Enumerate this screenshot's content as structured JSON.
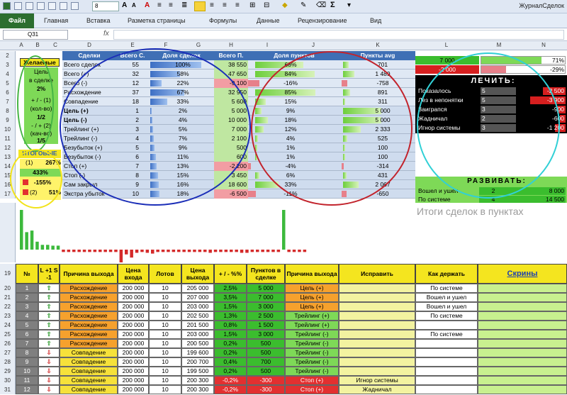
{
  "titlebar": {
    "text": "ЖурналСделок"
  },
  "ribbon": {
    "file": "Файл",
    "tabs": [
      "Главная",
      "Вставка",
      "Разметка страницы",
      "Формулы",
      "Данные",
      "Рецензирование",
      "Вид"
    ]
  },
  "font_size": "8",
  "namebox": "Q31",
  "col_letters": [
    "A",
    "B",
    "C",
    "D",
    "E",
    "F",
    "G",
    "H",
    "I",
    "J",
    "K",
    "L",
    "M",
    "N"
  ],
  "left_panel": {
    "title": "Желаемые",
    "goal_line1": "Цель",
    "goal_line2": "в сделке",
    "goal_pct": "2%",
    "plus_minus1": "+ / - (1)",
    "kolvo": "(кол-во)",
    "ratio1": "1/2",
    "plus_minus2": "- / + (2)",
    "kachvo": "(кач-во)",
    "ratio2": "1/5",
    "itog": "ИТОГОВЫЕ",
    "i1_label": "(1)",
    "i1_val": "267%",
    "i2_val": "433%",
    "i3_val": "-155%",
    "i4_label": "(2)",
    "i4_val": "51%"
  },
  "stats": {
    "headers": [
      "Сделки",
      "Всего С.",
      "Доля сделок",
      "Всего П.",
      "Доля пунктов",
      "Пункты avg"
    ],
    "rows": [
      {
        "name": "Всего сделок",
        "n": "55",
        "pct": "100%",
        "pts": "38 550",
        "ppct": "68%",
        "avg": "701"
      },
      {
        "name": "Всего (+)",
        "n": "32",
        "pct": "58%",
        "pts": "47 650",
        "ppct": "84%",
        "avg": "1 489"
      },
      {
        "name": "Всего (-)",
        "n": "12",
        "pct": "22%",
        "pts": "-9 100",
        "ppct": "-16%",
        "avg": "-758"
      },
      {
        "name": "Расхождение",
        "n": "37",
        "pct": "67%",
        "pts": "32 950",
        "ppct": "85%",
        "avg": "891"
      },
      {
        "name": "Совпадение",
        "n": "18",
        "pct": "33%",
        "pts": "5 600",
        "ppct": "15%",
        "avg": "311"
      },
      {
        "name": "Цель (+)",
        "n": "1",
        "pct": "2%",
        "pts": "5 000",
        "ppct": "9%",
        "avg": "5 000"
      },
      {
        "name": "Цель (-)",
        "n": "2",
        "pct": "4%",
        "pts": "10 000",
        "ppct": "18%",
        "avg": "5 000"
      },
      {
        "name": "Трейлинг (+)",
        "n": "3",
        "pct": "5%",
        "pts": "7 000",
        "ppct": "12%",
        "avg": "2 333"
      },
      {
        "name": "Трейлинг (-)",
        "n": "4",
        "pct": "7%",
        "pts": "2 100",
        "ppct": "4%",
        "avg": "525"
      },
      {
        "name": "Безубыток (+)",
        "n": "5",
        "pct": "9%",
        "pts": "500",
        "ppct": "1%",
        "avg": "100"
      },
      {
        "name": "Безубыток (-)",
        "n": "6",
        "pct": "11%",
        "pts": "600",
        "ppct": "1%",
        "avg": "100"
      },
      {
        "name": "Стоп (+)",
        "n": "7",
        "pct": "13%",
        "pts": "-2 200",
        "ppct": "-4%",
        "avg": "-314"
      },
      {
        "name": "Стоп (-)",
        "n": "8",
        "pct": "15%",
        "pts": "3 450",
        "ppct": "6%",
        "avg": "431"
      },
      {
        "name": "Сам закрыл",
        "n": "9",
        "pct": "16%",
        "pts": "18 600",
        "ppct": "33%",
        "avg": "2 067"
      },
      {
        "name": "Экстра убыток",
        "n": "10",
        "pct": "18%",
        "pts": "-6 500",
        "ppct": "-11%",
        "avg": "-650"
      }
    ]
  },
  "right_panel": {
    "top1_val": "7 000",
    "top1_pct": "71%",
    "top2_val": "-2 000",
    "top2_pct": "-29%",
    "lechit": "ЛЕЧИТЬ:",
    "lechit_items": [
      {
        "label": "Показалось",
        "n": "5",
        "v": "-2 500"
      },
      {
        "label": "Лез в непонятки",
        "n": "5",
        "v": "-3 900"
      },
      {
        "label": "Заиграпся",
        "n": "3",
        "v": "-900"
      },
      {
        "label": "Жадничал",
        "n": "2",
        "v": "-600"
      },
      {
        "label": "Игнор системы",
        "n": "3",
        "v": "-1 200"
      }
    ],
    "razvivat": "РАЗВИВАТЬ:",
    "razv_items": [
      {
        "label": "Вошел и ушел",
        "n": "2",
        "v": "8 000"
      },
      {
        "label": "По системе",
        "n": "4",
        "v": "14 500"
      }
    ]
  },
  "chart_data": {
    "type": "bar",
    "title": "Итоги сделок в пунктах",
    "values": [
      5000,
      2200,
      2400,
      1000,
      600,
      600,
      500,
      500,
      -300,
      -300,
      -300,
      -300,
      -300,
      -300,
      -300,
      -300,
      -300,
      -300,
      -300,
      -2200,
      -600,
      -1000,
      -400,
      -300,
      -400,
      -500,
      -300,
      -300,
      -300,
      -300,
      -300,
      -300,
      -300,
      -300,
      -300,
      -300,
      -400,
      -300,
      -300,
      -300,
      -300,
      -300,
      -400,
      -400,
      -300,
      -300,
      -300,
      -300,
      -300,
      -300,
      5000,
      -300,
      -300,
      -300,
      -300
    ],
    "pos_color": "#3cb93c",
    "neg_color": "#d42a2a"
  },
  "journal": {
    "headers": [
      "№",
      "L +1\nS -1",
      "Причина выхода",
      "Цена входа",
      "Лотов",
      "Цена выхода",
      "+ / - %%",
      "Пунктов в сделке",
      "Причина выхода",
      "Исправить",
      "Как держать",
      "Скрины"
    ],
    "rows": [
      {
        "rn": "20",
        "no": "1",
        "dir": "up",
        "reason": "Расхождение",
        "in": "200 000",
        "lots": "10",
        "out": "205 000",
        "pct": "2,5%",
        "pts": "5 000",
        "exit": "Цель (+)",
        "fix": "",
        "hold": "По системе"
      },
      {
        "rn": "21",
        "no": "2",
        "dir": "up",
        "reason": "Расхождение",
        "in": "200 000",
        "lots": "10",
        "out": "207 000",
        "pct": "3,5%",
        "pts": "7 000",
        "exit": "Цель (+)",
        "fix": "",
        "hold": "Вошел и ушел"
      },
      {
        "rn": "22",
        "no": "3",
        "dir": "up",
        "reason": "Расхождение",
        "in": "200 000",
        "lots": "10",
        "out": "203 000",
        "pct": "1,5%",
        "pts": "3 000",
        "exit": "Цель (+)",
        "fix": "",
        "hold": "Вошел и ушел"
      },
      {
        "rn": "23",
        "no": "4",
        "dir": "up",
        "reason": "Расхождение",
        "in": "200 000",
        "lots": "10",
        "out": "202 500",
        "pct": "1,3%",
        "pts": "2 500",
        "exit": "Трейлинг (+)",
        "fix": "",
        "hold": "По системе"
      },
      {
        "rn": "24",
        "no": "5",
        "dir": "up",
        "reason": "Расхождение",
        "in": "200 000",
        "lots": "10",
        "out": "201 500",
        "pct": "0,8%",
        "pts": "1 500",
        "exit": "Трейлинг (+)",
        "fix": "",
        "hold": ""
      },
      {
        "rn": "25",
        "no": "6",
        "dir": "up",
        "reason": "Расхождение",
        "in": "200 000",
        "lots": "10",
        "out": "203 000",
        "pct": "1,5%",
        "pts": "3 000",
        "exit": "Трейлинг (-)",
        "fix": "",
        "hold": "По системе"
      },
      {
        "rn": "26",
        "no": "7",
        "dir": "up",
        "reason": "Расхождение",
        "in": "200 000",
        "lots": "10",
        "out": "200 500",
        "pct": "0,2%",
        "pts": "500",
        "exit": "Трейлинг (-)",
        "fix": "",
        "hold": ""
      },
      {
        "rn": "27",
        "no": "8",
        "dir": "dn",
        "reason": "Совпадение",
        "in": "200 000",
        "lots": "10",
        "out": "199 600",
        "pct": "0,2%",
        "pts": "500",
        "exit": "Трейлинг (-)",
        "fix": "",
        "hold": ""
      },
      {
        "rn": "28",
        "no": "9",
        "dir": "dn",
        "reason": "Совпадение",
        "in": "200 000",
        "lots": "10",
        "out": "200 700",
        "pct": "0,4%",
        "pts": "700",
        "exit": "Трейлинг (-)",
        "fix": "",
        "hold": ""
      },
      {
        "rn": "29",
        "no": "10",
        "dir": "dn",
        "reason": "Совпадение",
        "in": "200 000",
        "lots": "10",
        "out": "199 500",
        "pct": "0,2%",
        "pts": "500",
        "exit": "Трейлинг (-)",
        "fix": "",
        "hold": ""
      },
      {
        "rn": "30",
        "no": "11",
        "dir": "dn",
        "reason": "Совпадение",
        "in": "200 000",
        "lots": "10",
        "out": "200 300",
        "pct": "-0,2%",
        "pts": "-300",
        "exit": "Стоп (+)",
        "fix": "Игнор системы",
        "hold": ""
      },
      {
        "rn": "31",
        "no": "12",
        "dir": "dn",
        "reason": "Совпадение",
        "in": "200 000",
        "lots": "10",
        "out": "200 300",
        "pct": "-0,2%",
        "pts": "-300",
        "exit": "Стоп (+)",
        "fix": "Жадничал",
        "hold": ""
      }
    ]
  },
  "colors": {
    "yellow": "#f4e51f",
    "green": "#7ed957",
    "red": "#e23030",
    "blue_hdr": "#3f6fb5",
    "grey_panel": "#d9d9d9"
  }
}
